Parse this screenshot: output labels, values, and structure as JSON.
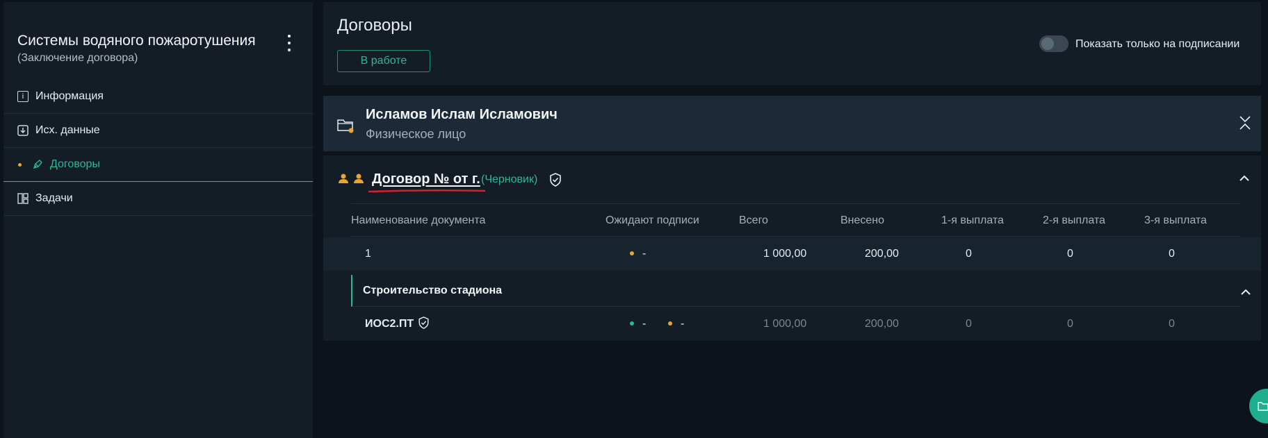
{
  "sidebar": {
    "project_title": "Системы водяного пожаротушения",
    "project_subtitle": "(Заключение договора)",
    "menu_icon": "kebab-menu-icon",
    "items": [
      {
        "label": "Информация",
        "icon": "info-icon",
        "active": false
      },
      {
        "label": "Исх. данные",
        "icon": "download-icon",
        "active": false
      },
      {
        "label": "Договоры",
        "icon": "pen-icon",
        "active": true
      },
      {
        "label": "Задачи",
        "icon": "board-icon",
        "active": false
      }
    ]
  },
  "header": {
    "title": "Договоры",
    "status_button": "В работе",
    "toggle_label": "Показать только на подписании",
    "toggle_on": false
  },
  "client": {
    "name": "Исламов Ислам Исламович",
    "type": "Физическое лицо"
  },
  "contract": {
    "title": "Договор № от г.",
    "status": "(Черновик)",
    "columns": [
      "Наименование документа",
      "Ожидают подписи",
      "Всего",
      "Внесено",
      "1-я выплата",
      "2-я выплата",
      "3-я выплата"
    ],
    "main_row": {
      "name": "1",
      "awaiting": "-",
      "total": "1 000,00",
      "paid": "200,00",
      "p1": "0",
      "p2": "0",
      "p3": "0"
    },
    "subsection": {
      "title": "Строительство стадиона",
      "rows": [
        {
          "name": "ИОС2.ПТ",
          "awaiting_a": "-",
          "awaiting_b": "-",
          "total": "1 000,00",
          "paid": "200,00",
          "p1": "0",
          "p2": "0",
          "p3": "0"
        }
      ]
    }
  },
  "colors": {
    "accent": "#2bb89a",
    "warning": "#e8a531",
    "background": "#0c131a",
    "panel": "#141d25"
  }
}
